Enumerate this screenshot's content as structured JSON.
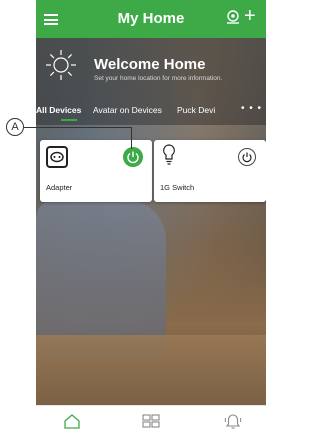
{
  "header": {
    "title": "My Home"
  },
  "welcome": {
    "title": "Welcome Home",
    "subtitle": "Set your home location for more information."
  },
  "tabs": [
    {
      "label": "All Devices",
      "active": true
    },
    {
      "label": "Avatar on Devices",
      "active": false
    },
    {
      "label": "Puck Devi",
      "active": false
    }
  ],
  "devices": [
    {
      "name": "Adapter",
      "icon": "plug-adapter-icon",
      "power": "on"
    },
    {
      "name": "1G Switch",
      "icon": "bulb-icon",
      "power": "off"
    }
  ],
  "callout": {
    "label": "A"
  },
  "bottom_nav": [
    {
      "icon": "home-icon",
      "active": true
    },
    {
      "icon": "grid-icon",
      "active": false
    },
    {
      "icon": "bell-icon",
      "active": false
    }
  ],
  "colors": {
    "accent": "#3daa47"
  }
}
